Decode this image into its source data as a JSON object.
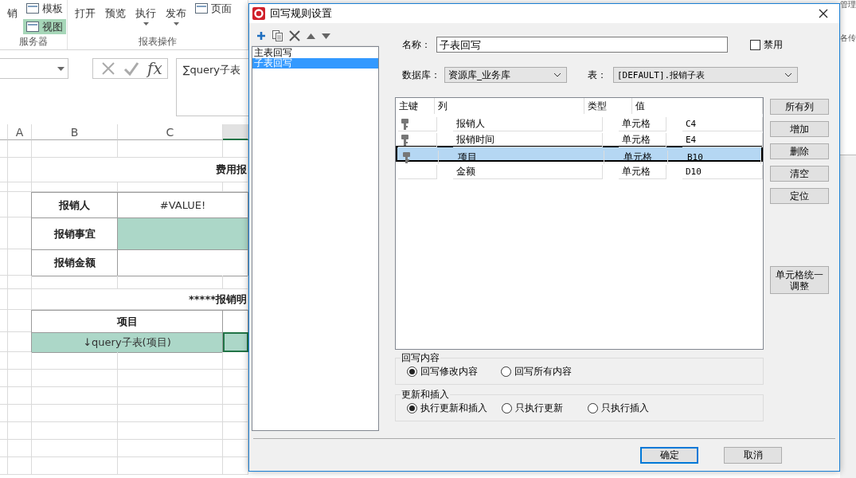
{
  "ribbon": {
    "groups": [
      {
        "label": "服务器",
        "items": [
          {
            "label": "销",
            "kind": "large",
            "selected": false,
            "dropdown": false
          },
          {
            "label": "模板",
            "kind": "small",
            "selected": false
          },
          {
            "label": "视图",
            "kind": "small",
            "selected": true
          }
        ]
      },
      {
        "label": "报表操作",
        "items": [
          {
            "label": "打开",
            "kind": "large",
            "selected": false,
            "dropdown": false
          },
          {
            "label": "预览",
            "kind": "large",
            "selected": false,
            "dropdown": false
          },
          {
            "label": "执行",
            "kind": "large",
            "selected": false,
            "dropdown": true
          },
          {
            "label": "发布",
            "kind": "large",
            "selected": false,
            "dropdown": true
          },
          {
            "label": "页面",
            "kind": "small",
            "selected": false
          }
        ]
      }
    ]
  },
  "formula_bar": {
    "function_button": "fx",
    "formula": "∑query子表"
  },
  "sheet": {
    "columns": [
      "A",
      "B",
      "C"
    ],
    "rows": [
      {
        "kind": "blank"
      },
      {
        "kind": "title",
        "text": "费用报"
      },
      {
        "kind": "blank"
      },
      {
        "kind": "field",
        "label": "报销人",
        "value": "#VALUE!",
        "highlighted": false
      },
      {
        "kind": "field",
        "label": "报销事宜",
        "highlighted": true
      },
      {
        "kind": "field",
        "label": "报销金额",
        "highlighted": false
      },
      {
        "kind": "blank"
      },
      {
        "kind": "title",
        "text": "*****报销明"
      },
      {
        "kind": "header",
        "text": "项目"
      },
      {
        "kind": "data",
        "text": "↓query子表(项目)",
        "highlighted": true
      },
      {
        "kind": "blank"
      },
      {
        "kind": "blank"
      },
      {
        "kind": "blank"
      },
      {
        "kind": "blank"
      },
      {
        "kind": "blank"
      },
      {
        "kind": "blank"
      },
      {
        "kind": "blank"
      }
    ]
  },
  "right_strip": {
    "texts": [
      "管理",
      "各传"
    ]
  },
  "dialog": {
    "title": "回写规则设置",
    "rules": [
      {
        "label": "主表回写",
        "selected": false
      },
      {
        "label": "子表回写",
        "selected": true
      }
    ],
    "name_label": "名称：",
    "name_value": "子表回写",
    "disable_checkbox": {
      "label": "禁用",
      "checked": false
    },
    "database_label": "数据库：",
    "database": "资源库_业务库",
    "table_label": "表：",
    "table": "[DEFAULT].报销子表",
    "grid": {
      "columns": [
        "主键",
        "列",
        "类型",
        "值"
      ],
      "rows": [
        {
          "primary_key": true,
          "column": "报销人",
          "type": "单元格",
          "value": "C4",
          "selected": false
        },
        {
          "primary_key": true,
          "column": "报销时间",
          "type": "单元格",
          "value": "E4",
          "selected": false
        },
        {
          "primary_key": true,
          "column": "项目",
          "type": "单元格",
          "value": "B10",
          "selected": true
        },
        {
          "primary_key": false,
          "column": "金额",
          "type": "单元格",
          "value": "D10",
          "selected": false
        }
      ]
    },
    "side_buttons": [
      "所有列",
      "增加",
      "删除",
      "清空",
      "定位",
      "单元格统一调整"
    ],
    "groups": [
      {
        "title": "回写内容",
        "options": [
          {
            "label": "回写修改内容",
            "selected": true
          },
          {
            "label": "回写所有内容",
            "selected": false
          }
        ]
      },
      {
        "title": "更新和插入",
        "options": [
          {
            "label": "执行更新和插入",
            "selected": true
          },
          {
            "label": "只执行更新",
            "selected": false
          },
          {
            "label": "只执行插入",
            "selected": false
          }
        ]
      }
    ],
    "buttons": [
      {
        "label": "确定",
        "default": true
      },
      {
        "label": "取消",
        "default": false
      }
    ]
  }
}
